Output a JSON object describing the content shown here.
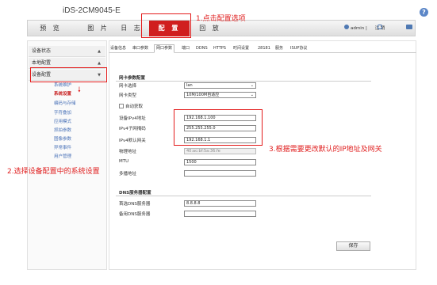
{
  "header": {
    "device_model": "iDS-2CM9045-E",
    "help_icon": "?",
    "user_name": "admin",
    "user_sep": "|",
    "logout_label": "注 销"
  },
  "nav": {
    "tabs": [
      {
        "label": "预 览"
      },
      {
        "label": "图 片"
      },
      {
        "label": "日 志"
      },
      {
        "label": "配 置"
      },
      {
        "label": "回 放"
      }
    ]
  },
  "sidebar": {
    "device_status": "设备状态",
    "local_config": "本地配置",
    "device_config": "设备配置",
    "sub_items": [
      "系统维护",
      "系统设置",
      "编码与存储",
      "字符叠加",
      "应用模式",
      "抓拍参数",
      "图像参数",
      "异常事件",
      "用户管理"
    ],
    "active_index": 1
  },
  "subtabs": [
    "设备信息",
    "串口参数",
    "网口参数",
    "端口",
    "DDNS",
    "HTTPS",
    "时间设置",
    "28181",
    "服务",
    "ISUP协议"
  ],
  "active_subtab": 2,
  "network": {
    "section_title": "网卡参数配置",
    "nic_select_label": "网卡选择",
    "nic_select_value": "lan",
    "nic_type_label": "网卡类型",
    "nic_type_value": "10M/100M自适应",
    "auto_get_label": "自动获取",
    "ipv4_label": "设备IPv4地址",
    "ipv4_value": "192.168.1.100",
    "mask_label": "IPv4子网掩码",
    "mask_value": "255.255.255.0",
    "gateway_label": "IPv4默认网关",
    "gateway_value": "192.168.1.1",
    "mac_label": "物理地址",
    "mac_value": "40:ac:bf:5a:36:fe",
    "mtu_label": "MTU",
    "mtu_value": "1500",
    "multicast_label": "多播地址",
    "multicast_value": ""
  },
  "dns": {
    "section_title": "DNS服务器配置",
    "primary_label": "首选DNS服务器",
    "primary_value": "8.8.8.8",
    "backup_label": "备用DNS服务器",
    "backup_value": ""
  },
  "save_label": "保存",
  "annotations": {
    "step1": "1.点击配置选项",
    "step2": "2.选择设备配置中的系统设置",
    "step3": "3.根据需要更改默认的IP地址及网关"
  },
  "colors": {
    "accent": "#d01f1f",
    "annotation": "#e02020",
    "link": "#4a72b8"
  }
}
